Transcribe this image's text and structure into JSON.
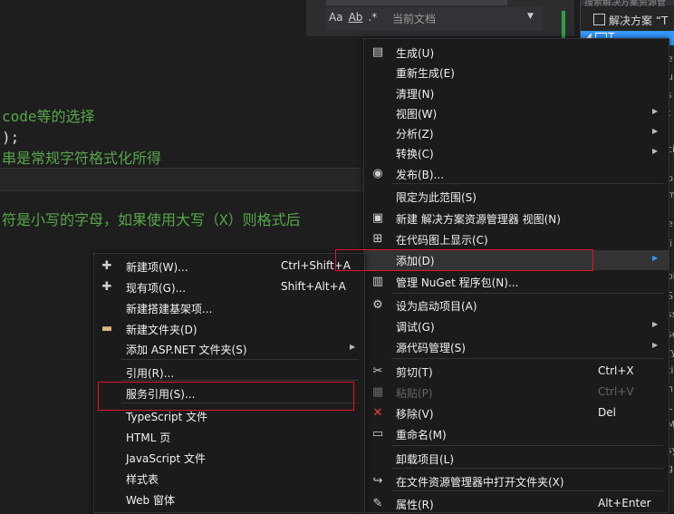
{
  "code": {
    "line1": "code等的选择",
    "line2": ");",
    "line3": "串是常规字符格式化所得",
    "line4": "符是小写的字母，如果使用大写（X）则格式后"
  },
  "solution_explorer": {
    "search_placeholder": "搜索解决方案资源管",
    "scope_label": "当前文档",
    "tree_item_solution": "解决方案 “T",
    "tree_item_selected": "T",
    "edge_chars": [
      "e",
      "u",
      "s",
      "t",
      "ci",
      "b",
      "m",
      "e",
      "li",
      "ol",
      "S",
      "ss",
      "sc",
      "ry",
      "ti",
      "n.",
      "L",
      "Ma",
      "sy",
      "g."
    ]
  },
  "main_menu": {
    "items": [
      {
        "label": "生成(U)",
        "icon": "build-icon"
      },
      {
        "label": "重新生成(E)"
      },
      {
        "label": "清理(N)"
      },
      {
        "label": "视图(W)",
        "submenu": true
      },
      {
        "label": "分析(Z)",
        "submenu": true
      },
      {
        "label": "转换(C)",
        "submenu": true
      },
      {
        "label": "发布(B)...",
        "icon": "publish-icon"
      },
      {
        "label": "限定为此范围(S)"
      },
      {
        "label": "新建 解决方案资源管理器 视图(N)",
        "icon": "new-view-icon"
      },
      {
        "label": "在代码图上显示(C)",
        "icon": "code-map-icon"
      },
      {
        "label": "添加(D)",
        "submenu": true
      },
      {
        "label": "管理 NuGet 程序包(N)...",
        "icon": "nuget-icon"
      },
      {
        "label": "设为启动项目(A)",
        "icon": "gear-icon"
      },
      {
        "label": "调试(G)",
        "submenu": true
      },
      {
        "label": "源代码管理(S)",
        "submenu": true
      },
      {
        "label": "剪切(T)",
        "shortcut": "Ctrl+X",
        "icon": "cut-icon"
      },
      {
        "label": "粘贴(P)",
        "shortcut": "Ctrl+V",
        "disabled": true,
        "icon": "paste-icon"
      },
      {
        "label": "移除(V)",
        "shortcut": "Del",
        "icon": "remove-icon"
      },
      {
        "label": "重命名(M)",
        "icon": "rename-icon"
      },
      {
        "label": "卸载项目(L)"
      },
      {
        "label": "在文件资源管理器中打开文件夹(X)",
        "icon": "open-folder-icon"
      },
      {
        "label": "属性(R)",
        "shortcut": "Alt+Enter",
        "icon": "wrench-icon"
      }
    ]
  },
  "add_submenu": {
    "items": [
      {
        "label": "新建项(W)...",
        "shortcut": "Ctrl+Shift+A",
        "icon": "new-item-icon"
      },
      {
        "label": "现有项(G)...",
        "shortcut": "Shift+Alt+A",
        "icon": "existing-item-icon"
      },
      {
        "label": "新建搭建基架项..."
      },
      {
        "label": "新建文件夹(D)",
        "icon": "folder-icon"
      },
      {
        "label": "添加 ASP.NET 文件夹(S)",
        "submenu": true
      },
      {
        "label": "引用(R)..."
      },
      {
        "label": "服务引用(S)..."
      },
      {
        "label": "TypeScript 文件"
      },
      {
        "label": "HTML 页"
      },
      {
        "label": "JavaScript 文件"
      },
      {
        "label": "样式表"
      },
      {
        "label": "Web 窗体"
      }
    ]
  },
  "colors": {
    "accent_blue": "#3399ff",
    "comment_green": "#57a64a",
    "highlight_red": "#e81123"
  }
}
